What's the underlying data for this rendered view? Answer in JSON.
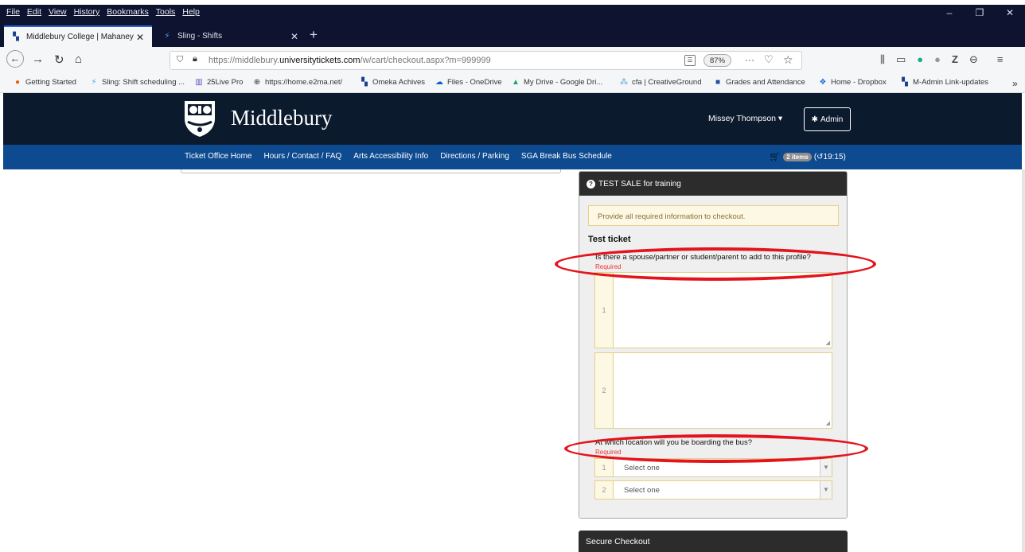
{
  "browser": {
    "menu": [
      "File",
      "Edit",
      "View",
      "History",
      "Bookmarks",
      "Tools",
      "Help"
    ],
    "tabs": [
      {
        "title": "Middlebury College | Mahaney",
        "active": true
      },
      {
        "title": "Sling - Shifts",
        "active": false
      }
    ],
    "url_prefix": "https://middlebury.",
    "url_domain": "universitytickets.com",
    "url_path": "/w/cart/checkout.aspx?m=999999",
    "zoom": "87%",
    "more": "···",
    "bookmarks": [
      "Getting Started",
      "Sling: Shift scheduling ...",
      "25Live Pro",
      "https://home.e2ma.net/",
      "Omeka Achives",
      "Files - OneDrive",
      "My Drive - Google Dri...",
      "cfa | CreativeGround",
      "Grades and Attendance",
      "Home - Dropbox",
      "M-Admin Link-updates"
    ]
  },
  "site": {
    "brand": "Middlebury",
    "user": "Missey Thompson",
    "admin_label": "Admin",
    "nav": [
      "Ticket Office Home",
      "Hours / Contact / FAQ",
      "Arts Accessibility Info",
      "Directions / Parking",
      "SGA Break Bus Schedule"
    ],
    "cart_badge": "2 items",
    "cart_timer": "(↺19:15)"
  },
  "checkout": {
    "panel_title": "TEST SALE for training",
    "alert": "Provide all required information to checkout.",
    "ticket_name": "Test ticket",
    "q1": "Is there a spouse/partner or student/parent to add to this profile?",
    "q1_required": "Required",
    "q2": "At which location will you be boarding the bus?",
    "q2_required": "Required",
    "row1": "1",
    "row2": "2",
    "select_placeholder": "Select one",
    "secure_title": "Secure Checkout"
  }
}
